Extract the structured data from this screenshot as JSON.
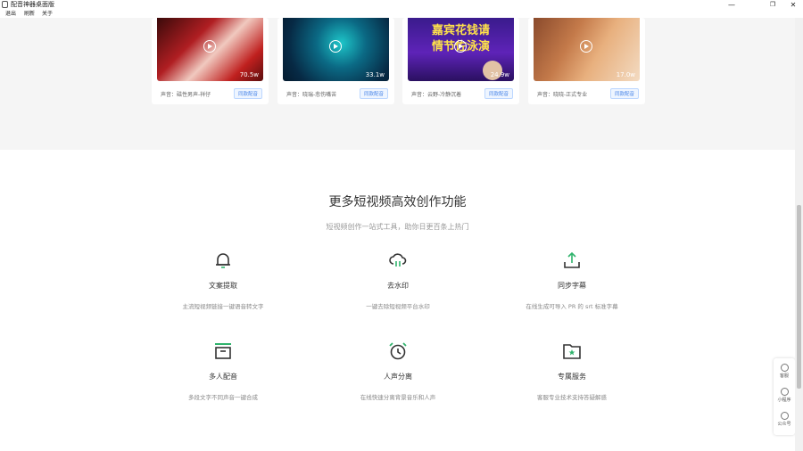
{
  "window": {
    "title": "配音神器桌面版",
    "controls": {
      "minimize": "—",
      "maximize": "❐",
      "close": "✕"
    }
  },
  "menu": [
    "退出",
    "刷新",
    "关于"
  ],
  "cards": [
    {
      "views": "70.5w",
      "voice": "声音：磁性男声-祥仔",
      "button": "同款配音"
    },
    {
      "views": "33.1w",
      "voice": "声音：晓瑞-悲伤嘴苦",
      "button": "同款配音"
    },
    {
      "views": "24.9w",
      "voice": "声音：云野-冷静沉着",
      "button": "同款配音",
      "thumb_text": [
        "嘉宾花钱请",
        "情节佐泳演"
      ]
    },
    {
      "views": "17.0w",
      "voice": "声音：晓晓-正式专业",
      "button": "同款配音"
    }
  ],
  "section": {
    "title": "更多短视频高效创作功能",
    "subtitle": "短视频创作一站式工具，助你日更百条上热门"
  },
  "features": [
    {
      "icon": "bell-icon",
      "name": "文案提取",
      "desc": "主流短视频链接一键语音转文字"
    },
    {
      "icon": "cloud-icon",
      "name": "去水印",
      "desc": "一键去除短视频平台水印"
    },
    {
      "icon": "upload-icon",
      "name": "同步字幕",
      "desc": "在线生成可导入 PR 的 srt 标准字幕"
    },
    {
      "icon": "box-icon",
      "name": "多人配音",
      "desc": "多段文字不同声音一键合成"
    },
    {
      "icon": "alarm-icon",
      "name": "人声分离",
      "desc": "在线快速分离背景音乐和人声"
    },
    {
      "icon": "folder-star-icon",
      "name": "专属服务",
      "desc": "客服专业技术支持答疑解惑"
    }
  ],
  "float_panel": [
    {
      "icon": "chat-icon",
      "label": "客服"
    },
    {
      "icon": "compass-icon",
      "label": "小程序"
    },
    {
      "icon": "wechat-icon",
      "label": "公众号"
    }
  ],
  "colors": {
    "accent_green": "#2fb36c",
    "link_blue": "#4a86e8"
  }
}
